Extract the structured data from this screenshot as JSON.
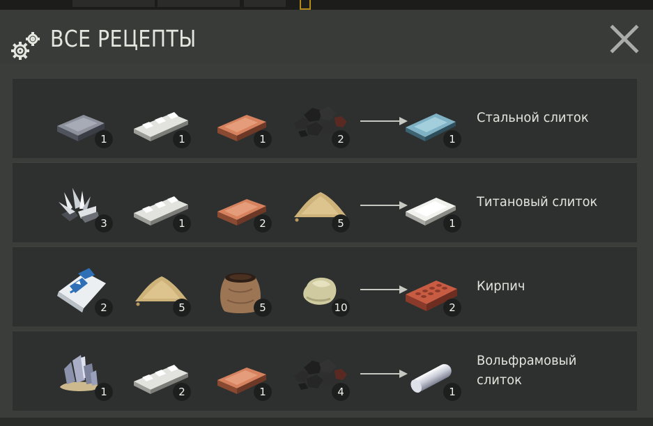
{
  "window": {
    "title": "ВСЕ РЕЦЕПТЫ",
    "title_icon": "gear-icon",
    "close_icon": "close-icon"
  },
  "colors": {
    "panel_bg": "#3a3d3a",
    "row_bg": "#2d302e",
    "badge_bg": "#1d1f1e",
    "text": "#e4e4de"
  },
  "recipes": [
    {
      "ingredients": [
        {
          "icon": "iron-ingot-icon",
          "count": "1"
        },
        {
          "icon": "aluminum-ingot-icon",
          "count": "1"
        },
        {
          "icon": "copper-ingot-icon",
          "count": "1"
        },
        {
          "icon": "coal-icon",
          "count": "2"
        }
      ],
      "result": {
        "icon": "steel-ingot-icon",
        "count": "1",
        "name": "Стальной слиток"
      }
    },
    {
      "ingredients": [
        {
          "icon": "titanium-ore-icon",
          "count": "3"
        },
        {
          "icon": "aluminum-ingot-icon",
          "count": "1"
        },
        {
          "icon": "copper-ingot-icon",
          "count": "2"
        },
        {
          "icon": "sand-icon",
          "count": "5"
        }
      ],
      "result": {
        "icon": "titanium-ingot-icon",
        "count": "1",
        "name": "Титановый слиток"
      }
    },
    {
      "ingredients": [
        {
          "icon": "cement-bag-icon",
          "count": "2"
        },
        {
          "icon": "sand-icon",
          "count": "5"
        },
        {
          "icon": "soil-sack-icon",
          "count": "5"
        },
        {
          "icon": "clay-icon",
          "count": "10"
        }
      ],
      "result": {
        "icon": "brick-icon",
        "count": "2",
        "name": "Кирпич"
      }
    },
    {
      "ingredients": [
        {
          "icon": "tungsten-ore-icon",
          "count": "1"
        },
        {
          "icon": "aluminum-ingot-icon",
          "count": "2"
        },
        {
          "icon": "copper-ingot-icon",
          "count": "1"
        },
        {
          "icon": "coal-icon",
          "count": "4"
        }
      ],
      "result": {
        "icon": "tungsten-ingot-icon",
        "count": "1",
        "name": "Вольфрамовый слиток"
      }
    }
  ]
}
